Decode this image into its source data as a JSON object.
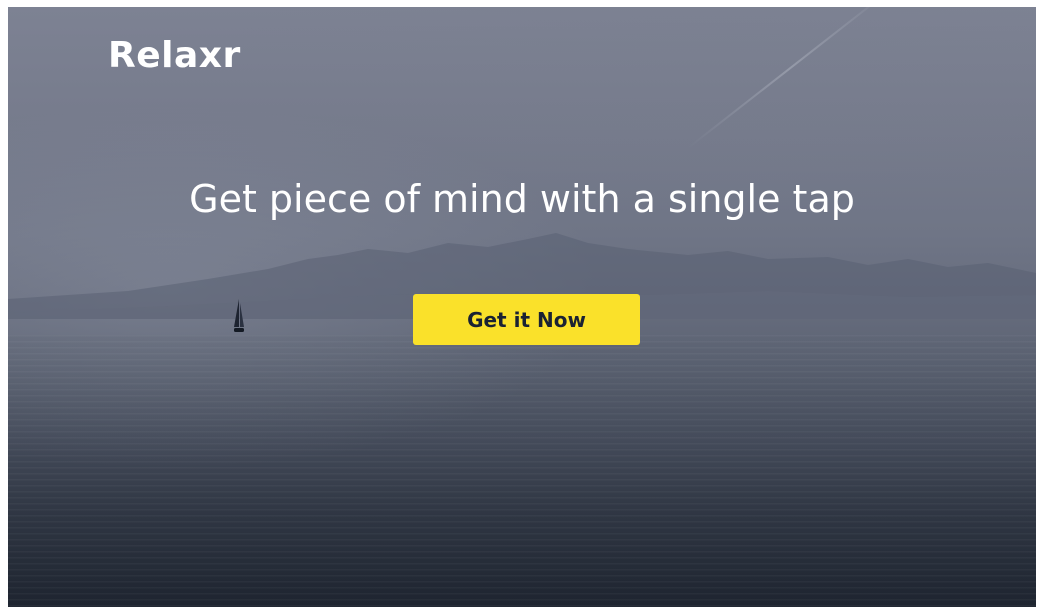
{
  "brand": {
    "name": "Relaxr"
  },
  "hero": {
    "headline": "Get piece of mind with a single tap",
    "cta_label": "Get it Now"
  },
  "colors": {
    "cta_background": "#fae12a",
    "cta_text": "#1a2233",
    "text": "#ffffff",
    "sky": "#767b8c",
    "sea": "#232a36"
  }
}
